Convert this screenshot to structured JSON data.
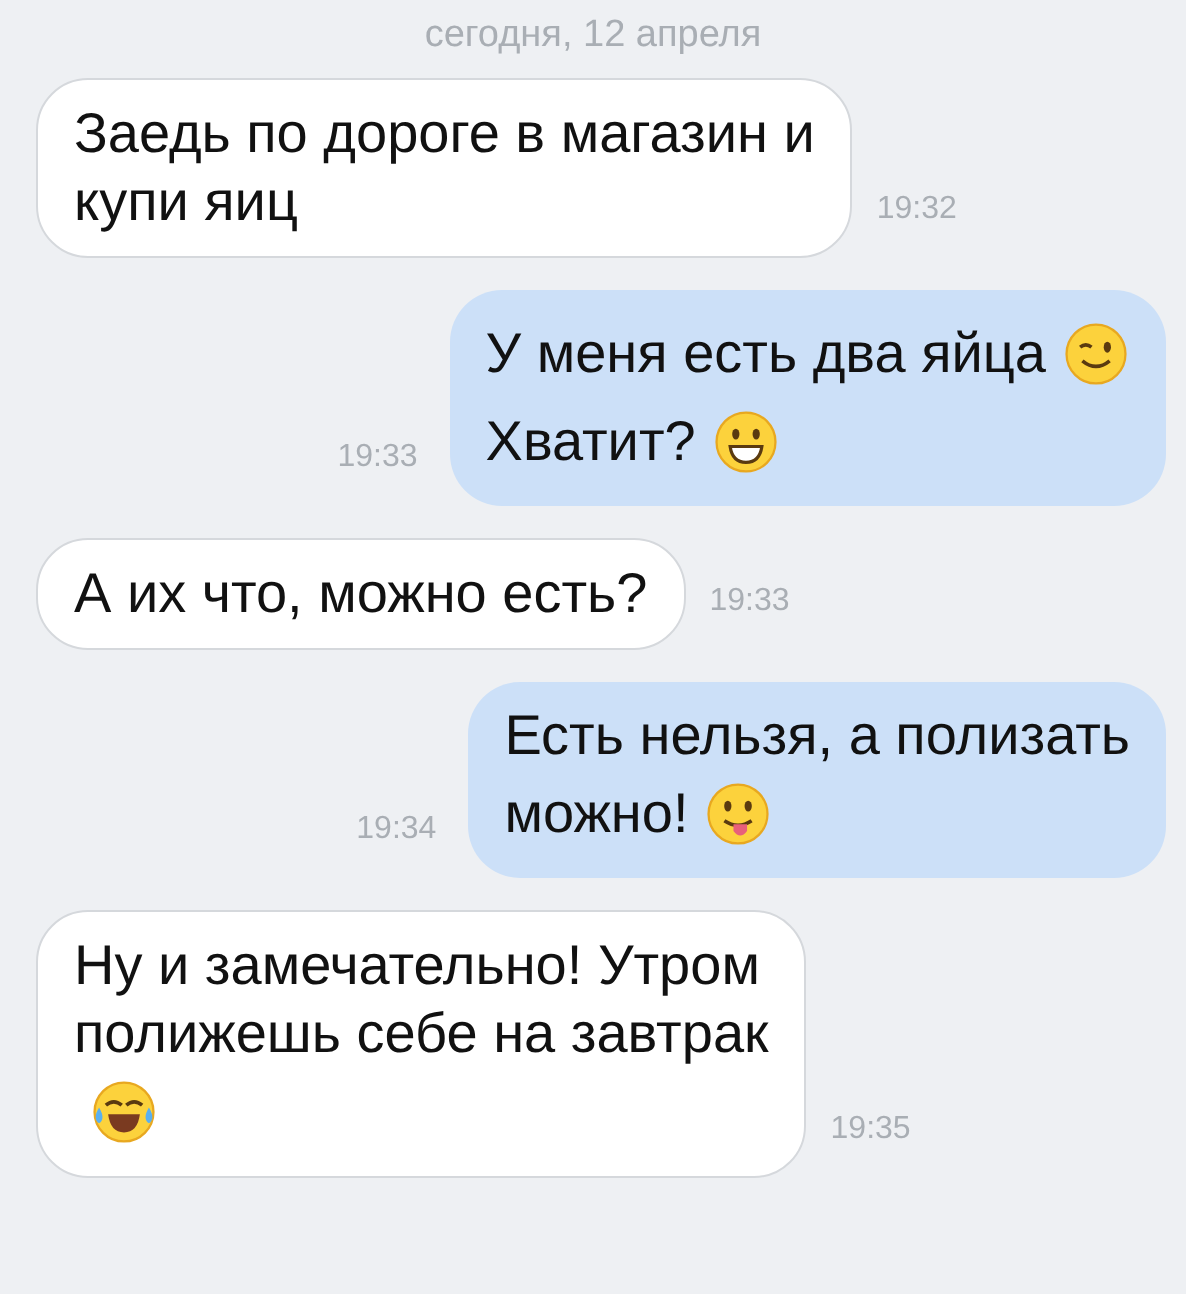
{
  "date_header": "сегодня, 12 апреля",
  "messages": [
    {
      "kind": "incoming",
      "time": "19:32",
      "lines": [
        [
          {
            "kind": "text",
            "text": "Заедь по дороге в магазин и"
          }
        ],
        [
          {
            "kind": "text",
            "text": "купи яиц"
          }
        ]
      ]
    },
    {
      "kind": "outgoing",
      "time": "19:33",
      "lines": [
        [
          {
            "kind": "text",
            "text": "У меня есть два яйца"
          },
          {
            "kind": "wink"
          }
        ],
        [
          {
            "kind": "text",
            "text": "Хватит?"
          },
          {
            "kind": "grin"
          }
        ]
      ]
    },
    {
      "kind": "incoming",
      "time": "19:33",
      "lines": [
        [
          {
            "kind": "text",
            "text": "А их что, можно есть?"
          }
        ]
      ]
    },
    {
      "kind": "outgoing",
      "time": "19:34",
      "lines": [
        [
          {
            "kind": "text",
            "text": "Есть нельзя, а полизать"
          }
        ],
        [
          {
            "kind": "text",
            "text": "можно!"
          },
          {
            "kind": "tongue"
          }
        ]
      ]
    },
    {
      "kind": "incoming",
      "time": "19:35",
      "lines": [
        [
          {
            "kind": "text",
            "text": "Ну и замечательно! Утром"
          }
        ],
        [
          {
            "kind": "text",
            "text": "полижешь себе на завтрак"
          }
        ],
        [
          {
            "kind": "tears"
          }
        ]
      ]
    }
  ]
}
